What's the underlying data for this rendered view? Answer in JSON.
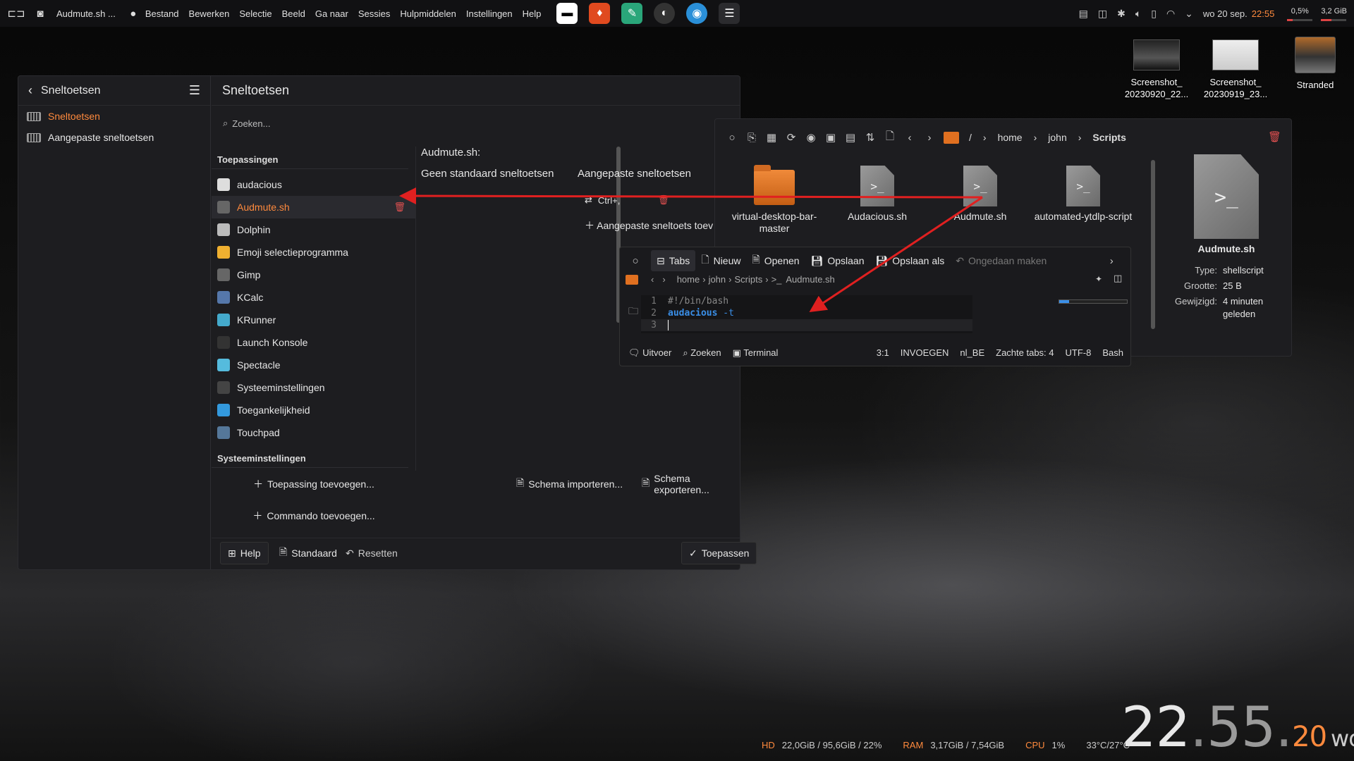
{
  "panel": {
    "window_title": "Audmute.sh ...",
    "menus": [
      "Bestand",
      "Bewerken",
      "Selectie",
      "Beeld",
      "Ga naar",
      "Sessies",
      "Hulpmiddelen",
      "Instellingen",
      "Help"
    ],
    "date": "wo 20 sep.",
    "time": "22:55",
    "cpu_meter": "0,5%",
    "ram_meter": "3,2 GiB"
  },
  "desktop": {
    "icons": [
      {
        "label": "Screenshot_ 20230920_22..."
      },
      {
        "label": "Screenshot_ 20230919_23..."
      },
      {
        "label": "Stranded"
      }
    ]
  },
  "settings": {
    "sidebar_title": "Sneltoetsen",
    "sidebar_items": [
      {
        "label": "Sneltoetsen",
        "active": true
      },
      {
        "label": "Aangepaste sneltoetsen",
        "active": false
      }
    ],
    "main_title": "Sneltoetsen",
    "search_placeholder": "Zoeken...",
    "section_apps": "Toepassingen",
    "section_sys": "Systeeminstellingen",
    "apps": [
      {
        "name": "audacious",
        "color": "#dddddd"
      },
      {
        "name": "Audmute.sh",
        "color": "#666666",
        "selected": true
      },
      {
        "name": "Dolphin",
        "color": "#bbbbbb"
      },
      {
        "name": "Emoji selectieprogramma",
        "color": "#f0b030"
      },
      {
        "name": "Gimp",
        "color": "#666666"
      },
      {
        "name": "KCalc",
        "color": "#5577aa"
      },
      {
        "name": "KRunner",
        "color": "#44aacc"
      },
      {
        "name": "Launch Konsole",
        "color": "#333333"
      },
      {
        "name": "Spectacle",
        "color": "#55bbdd"
      },
      {
        "name": "Systeeminstellingen",
        "color": "#444444"
      },
      {
        "name": "Toegankelijkheid",
        "color": "#3399dd"
      },
      {
        "name": "Touchpad",
        "color": "#557799"
      }
    ],
    "detail_title": "Audmute.sh:",
    "col_default": "Geen standaard sneltoetsen",
    "col_custom": "Aangepaste sneltoetsen",
    "shortcut": "Ctrl+,",
    "add_custom": "Aangepaste sneltoets toev",
    "btn_add_app": "Toepassing toevoegen...",
    "btn_add_cmd": "Commando toevoegen...",
    "btn_import": "Schema importeren...",
    "btn_export": "Schema exporteren...",
    "btn_help": "Help",
    "btn_default": "Standaard",
    "btn_reset": "Resetten",
    "btn_apply": "Toepassen"
  },
  "dolphin": {
    "breadcrumb": [
      "/",
      "home",
      "john",
      "Scripts"
    ],
    "files": [
      {
        "name": "virtual-desktop-bar-master",
        "kind": "folder"
      },
      {
        "name": "Audacious.sh",
        "kind": "script"
      },
      {
        "name": "Audmute.sh",
        "kind": "script"
      },
      {
        "name": "automated-ytdlp-script",
        "kind": "script"
      }
    ],
    "info": {
      "name": "Audmute.sh",
      "type_label": "Type:",
      "type": "shellscript",
      "size_label": "Grootte:",
      "size": "25 B",
      "modified_label": "Gewijzigd:",
      "modified": "4 minuten geleden"
    }
  },
  "kate": {
    "toolbar": [
      "Tabs",
      "Nieuw",
      "Openen",
      "Opslaan",
      "Opslaan als",
      "Ongedaan maken"
    ],
    "breadcrumb": [
      "home",
      "john",
      "Scripts",
      "Audmute.sh"
    ],
    "lines": [
      {
        "n": "1",
        "text": "#!/bin/bash"
      },
      {
        "n": "2",
        "cmd": "audacious",
        "arg": "-t"
      },
      {
        "n": "3",
        "text": ""
      }
    ],
    "status_left": [
      "Uitvoer",
      "Zoeken",
      "Terminal"
    ],
    "status_right": [
      "3:1",
      "INVOEGEN",
      "nl_BE",
      "Zachte tabs: 4",
      "UTF-8",
      "Bash"
    ]
  },
  "stats": {
    "hd_label": "HD",
    "hd": "22,0GiB / 95,6GiB / 22%",
    "ram_label": "RAM",
    "ram": "3,17GiB / 7,54GiB",
    "cpu_label": "CPU",
    "cpu": "1%",
    "temp": "33°C/27°C"
  },
  "bigclock": {
    "h": "22",
    "m": "55",
    "s": "20",
    "day": "wo"
  },
  "colors": {
    "accent": "#ff8a3d",
    "danger": "#e05050",
    "arrow": "#e02020"
  }
}
